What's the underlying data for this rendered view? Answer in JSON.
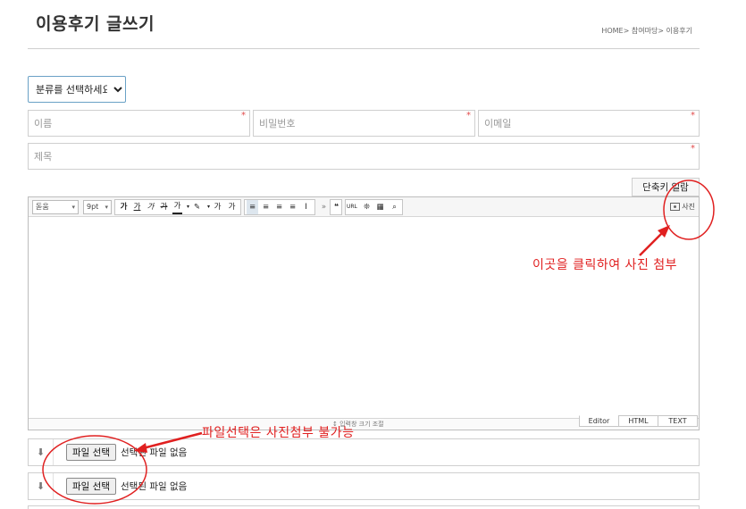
{
  "header": {
    "title": "이용후기 글쓰기",
    "breadcrumb": "HOME> 참여마당> 이용후기"
  },
  "form": {
    "category_selected": "분류를 선택하세요",
    "name_placeholder": "이름",
    "password_placeholder": "비밀번호",
    "email_placeholder": "이메일",
    "subject_placeholder": "제목",
    "required_mark": "*"
  },
  "editor": {
    "shortcut_label": "단축키 일람",
    "font_family": "돋움",
    "font_size": "9pt",
    "toolbar_buttons": [
      "가",
      "가",
      "가",
      "가",
      "가",
      "가",
      "가",
      "가"
    ],
    "photo_label": "사진",
    "resize_label": "↕ 입력창 크기 조절",
    "tabs": [
      "Editor",
      "HTML",
      "TEXT"
    ]
  },
  "files": [
    {
      "button_label": "파일 선택",
      "status": "선택된 파일 없음"
    },
    {
      "button_label": "파일 선택",
      "status": "선택된 파일 없음"
    }
  ],
  "annotations": {
    "photo_note": "이곳을 클릭하여 사진 첨부",
    "file_note": "파일선택은 사진첨부 불가능"
  },
  "colors": {
    "annotation": "#e02020",
    "select_border": "#6aa1c6",
    "required": "#e24a4a"
  }
}
